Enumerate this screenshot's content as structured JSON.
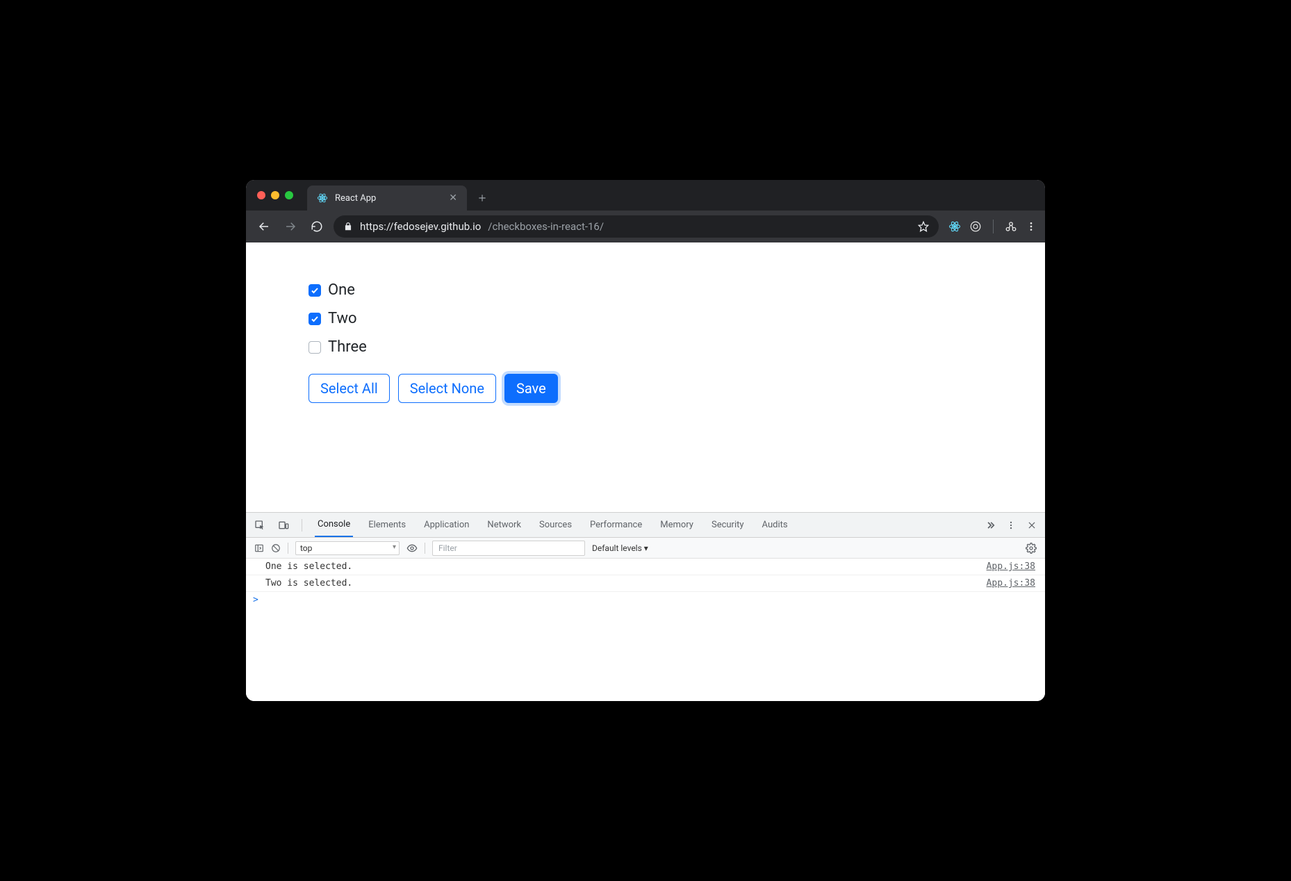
{
  "browser": {
    "tab_title": "React App",
    "url_host": "https://fedosejev.github.io",
    "url_path": "/checkboxes-in-react-16/"
  },
  "page": {
    "checkboxes": [
      {
        "label": "One",
        "checked": true
      },
      {
        "label": "Two",
        "checked": true
      },
      {
        "label": "Three",
        "checked": false
      }
    ],
    "buttons": {
      "select_all": "Select All",
      "select_none": "Select None",
      "save": "Save"
    }
  },
  "devtools": {
    "tabs": [
      "Console",
      "Elements",
      "Application",
      "Network",
      "Sources",
      "Performance",
      "Memory",
      "Security",
      "Audits"
    ],
    "active_tab": "Console",
    "context_selector": "top",
    "filter_placeholder": "Filter",
    "levels": "Default levels ▾",
    "console_rows": [
      {
        "msg": "One is selected.",
        "src": "App.js:38"
      },
      {
        "msg": "Two is selected.",
        "src": "App.js:38"
      }
    ],
    "prompt": ">"
  }
}
